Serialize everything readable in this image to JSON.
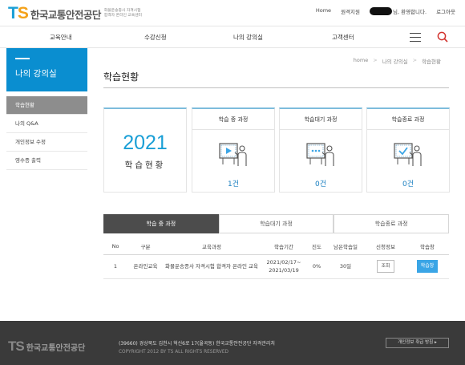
{
  "header": {
    "logo_ts": "TS",
    "logo_name": "한국교통안전공단",
    "logo_sub1": "화물운송종사 자격시험",
    "logo_sub2": "합격자 온라인 교육센터",
    "links": {
      "home": "Home",
      "remote": "원격지원",
      "welcome": "님, 환영합니다.",
      "logout": "로그아웃"
    }
  },
  "gnb": {
    "items": [
      "교육안내",
      "수강신청",
      "나의 강의실",
      "고객센터"
    ]
  },
  "lnb": {
    "title": "나의 강의실",
    "items": [
      "학습현황",
      "나의 Q&A",
      "개인정보 수정",
      "영수증 출력"
    ]
  },
  "breadcrumb": [
    "home",
    "나의 강의실",
    "학습현황"
  ],
  "page_title": "학습현황",
  "summary": {
    "year": "2021",
    "year_label": "학습현황",
    "cards": [
      {
        "title": "학습 중 과정",
        "count": "1건"
      },
      {
        "title": "학습대기 과정",
        "count": "0건"
      },
      {
        "title": "학습종료 과정",
        "count": "0건"
      }
    ]
  },
  "tabs": [
    "학습 중 과정",
    "학습대기 과정",
    "학습종료 과정"
  ],
  "table": {
    "headers": [
      "No",
      "구분",
      "교육과정",
      "학습기간",
      "진도",
      "남은학습일",
      "신청정보",
      "학습창"
    ],
    "rows": [
      {
        "no": "1",
        "type": "온라인교육",
        "course": "화물운송종사 자격시험 합격자 온라인 교육",
        "period_start": "2021/02/17~",
        "period_end": "2021/03/19",
        "progress": "0%",
        "remaining": "30일",
        "info_btn": "조회",
        "study_btn": "학습창"
      }
    ]
  },
  "footer": {
    "logo_ts": "TS",
    "logo_name": "한국교통안전공단",
    "address": "(39660) 경상북도 김천시 혁신6로 17(율곡동) 한국교통안전공단 자격관리처",
    "copyright": "COPYRIGHT 2012 BY TS ALL RIGHTS RESERVED",
    "privacy_btn": "개인정보 취급 방침 ▸"
  },
  "colors": {
    "brand_blue": "#1a9fd6",
    "brand_orange": "#f4a21a",
    "lnb_blue": "#0a8ed0",
    "footer_bg": "#3a3a3a"
  }
}
